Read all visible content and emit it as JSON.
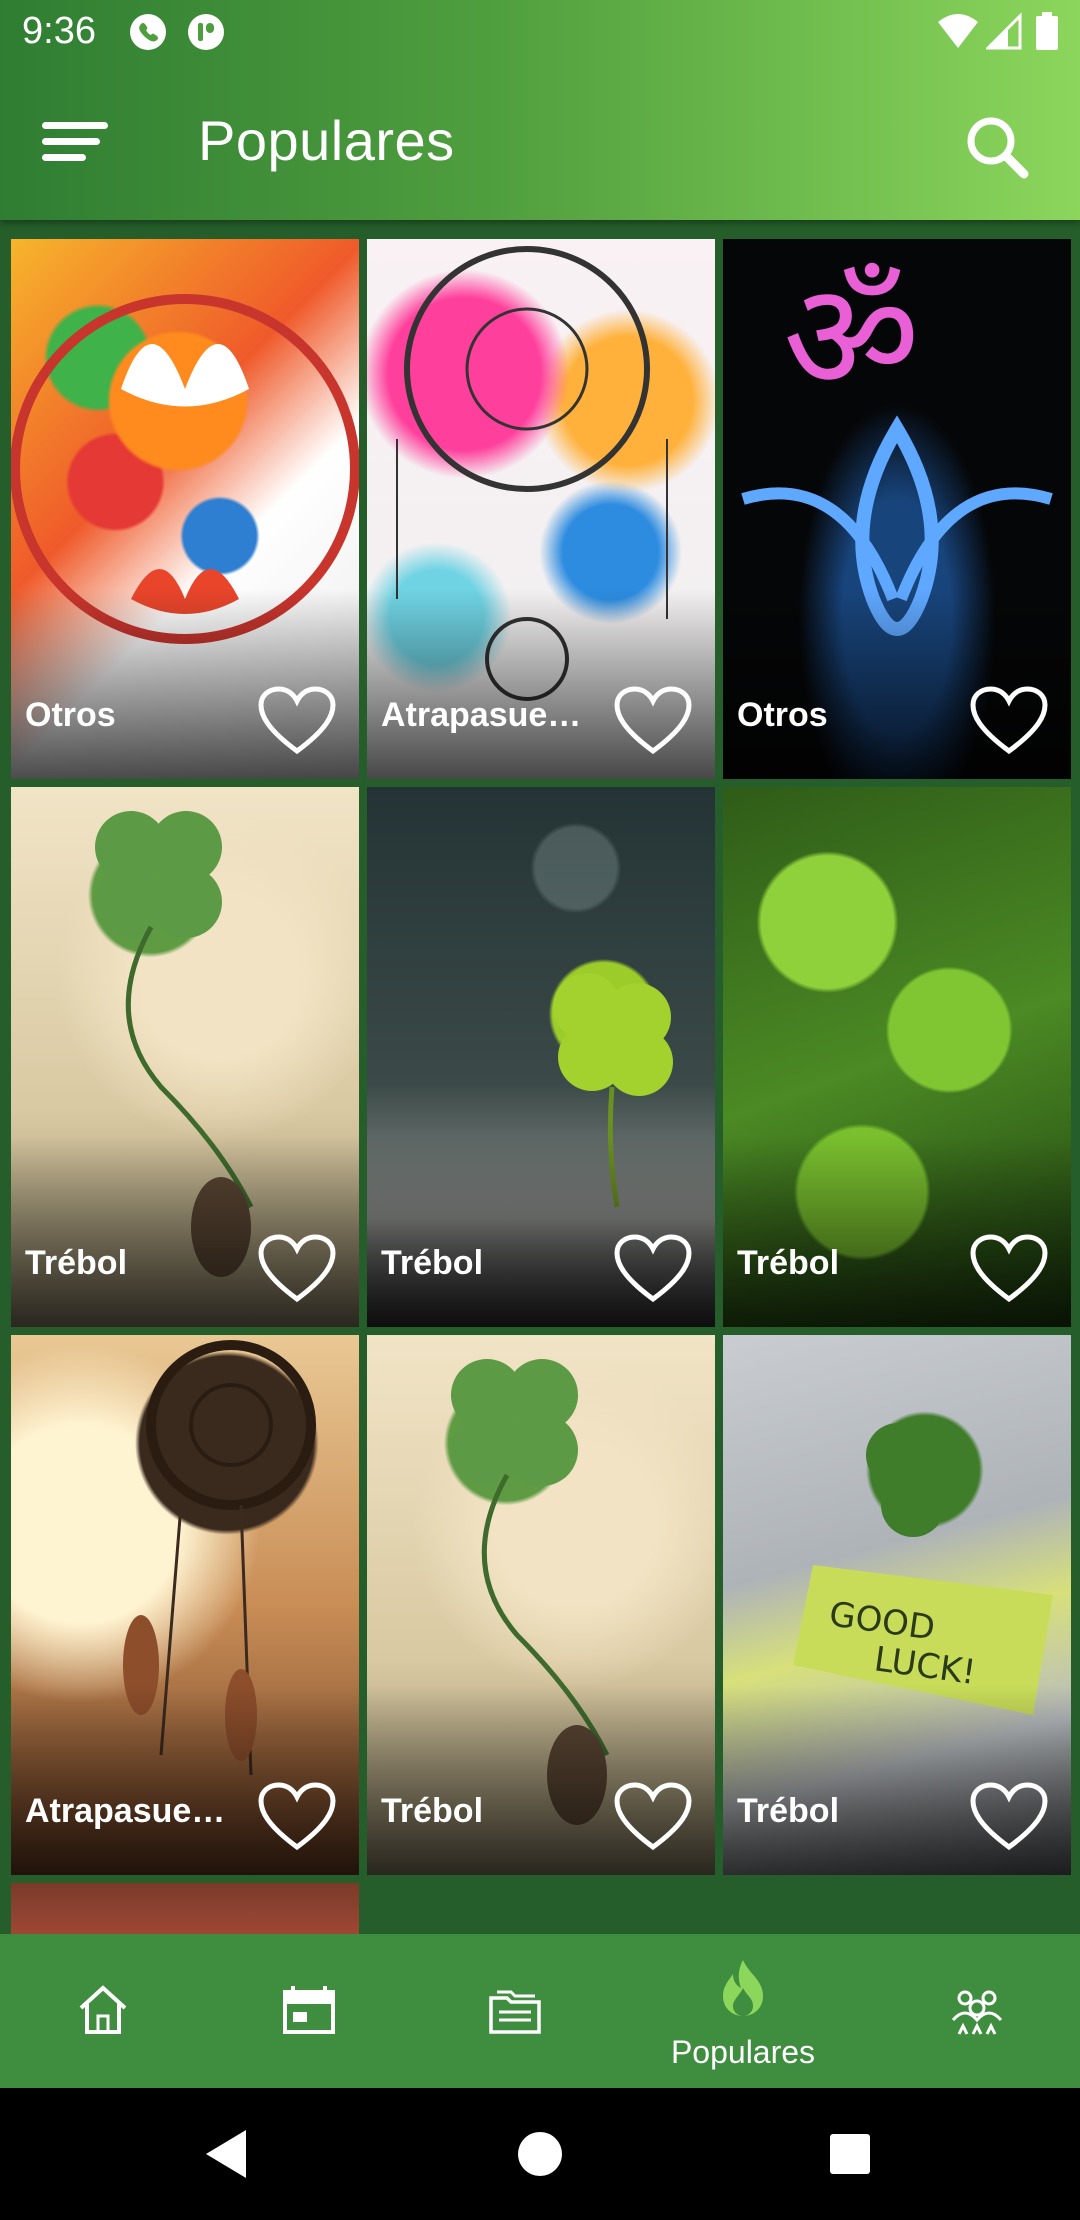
{
  "status_bar": {
    "time": "9:36",
    "left_icons": [
      "phone-icon",
      "app-notification-icon"
    ],
    "right_icons": [
      "wifi-icon",
      "signal-icon",
      "battery-icon"
    ]
  },
  "app_bar": {
    "title": "Populares",
    "menu_icon": "menu-icon",
    "search_icon": "search-icon"
  },
  "grid": {
    "items": [
      {
        "label": "Otros",
        "art": "yin-yang-lotus"
      },
      {
        "label": "Atrapasue…",
        "art": "dreamcatcher-watercolor"
      },
      {
        "label": "Otros",
        "art": "om-symbol"
      },
      {
        "label": "Trébol",
        "art": "clover-balloon-child"
      },
      {
        "label": "Trébol",
        "art": "clover-rock"
      },
      {
        "label": "Trébol",
        "art": "clover-dew"
      },
      {
        "label": "Atrapasue…",
        "art": "dreamcatcher-sunset"
      },
      {
        "label": "Trébol",
        "art": "clover-balloon-child"
      },
      {
        "label": "Trébol",
        "art": "clover-good-luck"
      }
    ],
    "favorite_icon": "heart-outline-icon"
  },
  "bottom_nav": {
    "items": [
      {
        "icon": "home-icon",
        "label": ""
      },
      {
        "icon": "calendar-icon",
        "label": ""
      },
      {
        "icon": "folders-icon",
        "label": ""
      },
      {
        "icon": "fire-icon",
        "label": "Populares",
        "active": true
      },
      {
        "icon": "group-icon",
        "label": ""
      }
    ]
  },
  "system_nav": [
    "back-icon",
    "home-circle-icon",
    "recents-icon"
  ],
  "colors": {
    "appbar_start": "#2f7d32",
    "appbar_end": "#8cd65c",
    "background": "#255e2a",
    "bottom_nav": "#3f8d3f",
    "active_icon": "#8cd65c"
  }
}
